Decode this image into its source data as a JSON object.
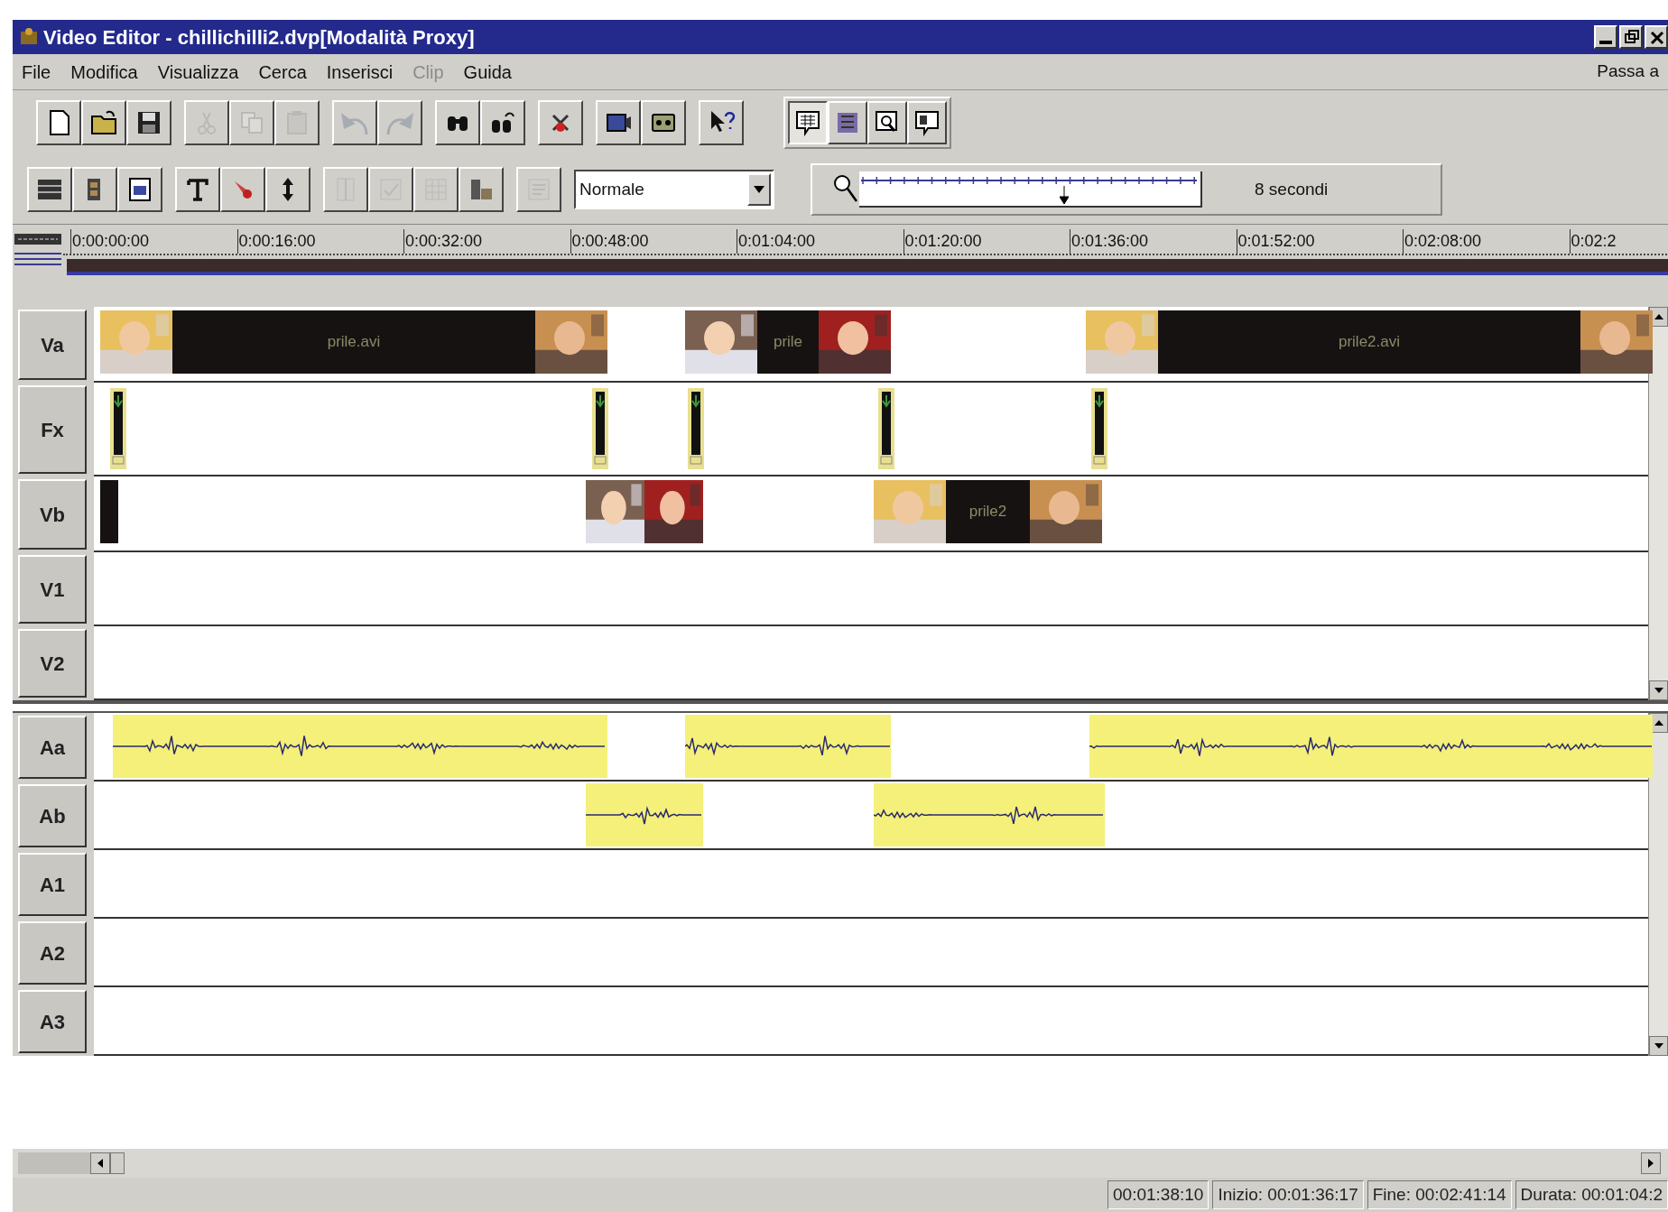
{
  "window": {
    "title": "Video Editor - chillichilli2.dvp[Modalità Proxy]"
  },
  "menu": {
    "items": [
      {
        "label": "File",
        "disabled": false
      },
      {
        "label": "Modifica",
        "disabled": false
      },
      {
        "label": "Visualizza",
        "disabled": false
      },
      {
        "label": "Cerca",
        "disabled": false
      },
      {
        "label": "Inserisci",
        "disabled": false
      },
      {
        "label": "Clip",
        "disabled": true
      },
      {
        "label": "Guida",
        "disabled": false
      }
    ],
    "right_label": "Passa a"
  },
  "toolbar": {
    "groups": [
      [
        {
          "kind": "new",
          "disabled": false
        },
        {
          "kind": "open",
          "disabled": false
        },
        {
          "kind": "save",
          "disabled": false
        }
      ],
      [
        {
          "kind": "cut",
          "disabled": true
        },
        {
          "kind": "copy",
          "disabled": true
        },
        {
          "kind": "paste",
          "disabled": true
        }
      ],
      [
        {
          "kind": "undo",
          "disabled": true
        },
        {
          "kind": "redo",
          "disabled": true
        }
      ],
      [
        {
          "kind": "find",
          "disabled": false
        },
        {
          "kind": "find-next",
          "disabled": false
        }
      ],
      [
        {
          "kind": "delete",
          "disabled": false
        }
      ],
      [
        {
          "kind": "capture",
          "disabled": false
        },
        {
          "kind": "tape",
          "disabled": false
        }
      ],
      [
        {
          "kind": "help",
          "disabled": false
        }
      ]
    ],
    "view_buttons": [
      {
        "kind": "storyboard",
        "selected": true
      },
      {
        "kind": "timeline",
        "selected": false
      },
      {
        "kind": "preview",
        "selected": false
      },
      {
        "kind": "list",
        "selected": false
      }
    ]
  },
  "toolbar2": {
    "groups": [
      [
        {
          "kind": "tracks",
          "disabled": false
        },
        {
          "kind": "clip",
          "disabled": false
        },
        {
          "kind": "page",
          "disabled": false
        }
      ],
      [
        {
          "kind": "text",
          "disabled": false
        },
        {
          "kind": "marker",
          "disabled": false
        },
        {
          "kind": "updown",
          "disabled": false
        }
      ],
      [
        {
          "kind": "split",
          "disabled": true
        },
        {
          "kind": "check",
          "disabled": true
        },
        {
          "kind": "grid",
          "disabled": true
        },
        {
          "kind": "film",
          "disabled": false
        }
      ],
      [
        {
          "kind": "props",
          "disabled": true
        }
      ]
    ],
    "mode_select": {
      "value": "Normale"
    },
    "zoom": {
      "level": 0.6,
      "reading": "8 secondi"
    }
  },
  "ruler": {
    "labels": [
      "0:00:00:00",
      "0:00:16:00",
      "0:00:32:00",
      "0:00:48:00",
      "0:01:04:00",
      "0:01:20:00",
      "0:01:36:00",
      "0:01:52:00",
      "0:02:08:00",
      "0:02:2"
    ]
  },
  "tracks": [
    {
      "label": "Va",
      "kind": "video",
      "clips": [
        {
          "kind": "video",
          "label": "prile.avi"
        },
        {
          "kind": "video",
          "label": "prile"
        },
        {
          "kind": "video",
          "label": "prile2.avi"
        }
      ]
    },
    {
      "label": "Fx",
      "kind": "fx",
      "clips": [
        {
          "kind": "transition"
        },
        {
          "kind": "transition"
        },
        {
          "kind": "transition"
        },
        {
          "kind": "transition"
        },
        {
          "kind": "transition"
        }
      ]
    },
    {
      "label": "Vb",
      "kind": "video",
      "clips": [
        {
          "kind": "video"
        },
        {
          "kind": "video"
        },
        {
          "kind": "video",
          "label": "prile2"
        }
      ]
    },
    {
      "label": "V1",
      "kind": "video"
    },
    {
      "label": "V2",
      "kind": "video"
    },
    {
      "label": "Aa",
      "kind": "audio",
      "clips": [
        {
          "kind": "audio"
        },
        {
          "kind": "audio"
        },
        {
          "kind": "audio"
        }
      ]
    },
    {
      "label": "Ab",
      "kind": "audio",
      "clips": [
        {
          "kind": "audio"
        },
        {
          "kind": "audio"
        }
      ]
    },
    {
      "label": "A1",
      "kind": "audio"
    },
    {
      "label": "A2",
      "kind": "audio"
    },
    {
      "label": "A3",
      "kind": "audio"
    }
  ],
  "status_bar": {
    "panels": [
      "00:01:38:10",
      "Inizio: 00:01:36:17",
      "Fine: 00:02:41:14",
      "Durata: 00:01:04:2"
    ]
  }
}
